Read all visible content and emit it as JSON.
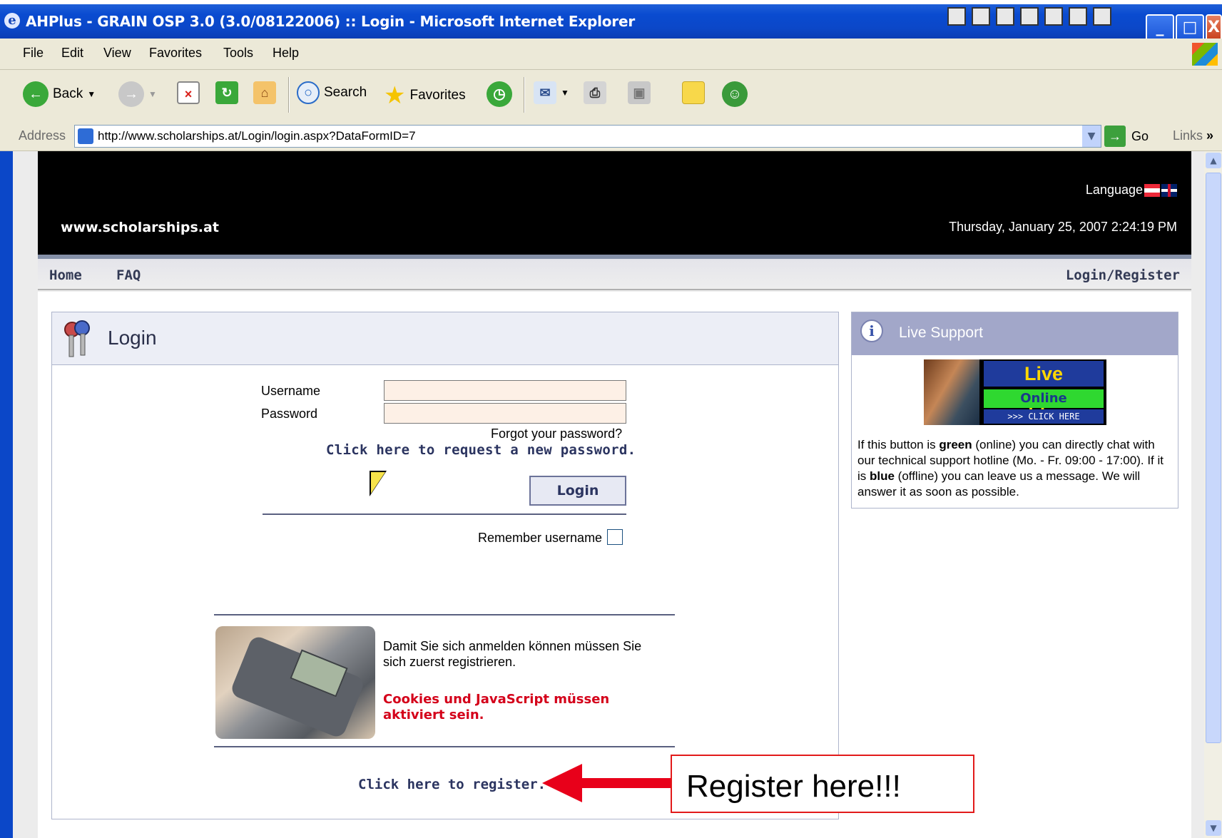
{
  "window": {
    "title": "AHPlus - GRAIN OSP 3.0 (3.0/08122006) :: Login - Microsoft Internet Explorer",
    "ie_icon": "e",
    "buttons": {
      "minimize": "_",
      "maximize": "□",
      "close": "X"
    }
  },
  "menu": [
    "File",
    "Edit",
    "View",
    "Favorites",
    "Tools",
    "Help"
  ],
  "toolbar": {
    "back_label": "Back",
    "search_label": "Search",
    "favorites_label": "Favorites"
  },
  "address": {
    "label": "Address",
    "url": "http://www.scholarships.at/Login/login.aspx?DataFormID=7",
    "go_label": "Go",
    "links_label": "Links",
    "chevron": "»"
  },
  "header": {
    "language_label": "Language",
    "site_name": "www.scholarships.at",
    "datetime": "Thursday, January 25, 2007 2:24:19 PM"
  },
  "nav": {
    "home": "Home",
    "faq": "FAQ",
    "login_register": "Login/Register"
  },
  "login": {
    "title": "Login",
    "username_label": "Username",
    "password_label": "Password",
    "username_value": "",
    "forgot_text": "Forgot your password?",
    "request_link": "Click here to request a new password.",
    "login_button": "Login",
    "remember_label": "Remember username",
    "info_text": "Damit Sie sich anmelden können müssen Sie sich zuerst registrieren.",
    "warning_text": "Cookies und JavaScript müssen aktiviert sein.",
    "register_link": "Click here to register."
  },
  "live_support": {
    "title": "Live Support",
    "banner_title": "Live Support!",
    "banner_status": "Online",
    "banner_click": ">>> CLICK HERE",
    "text_part1": "If this button is ",
    "text_green": "green",
    "text_part2": " (online) you can directly chat with our technical support hotline (Mo. - Fr. 09:00 - 17:00). If it is ",
    "text_blue": "blue",
    "text_part3": " (offline) you can leave us a message. We will answer it as soon as possible."
  },
  "annotation": {
    "callout_text": "Register here!!!"
  },
  "colors": {
    "title_bar": "#0a4bd0",
    "header_bg": "#000000",
    "link": "#2b3460",
    "warning": "#d4001a",
    "callout": "#e8001a"
  }
}
